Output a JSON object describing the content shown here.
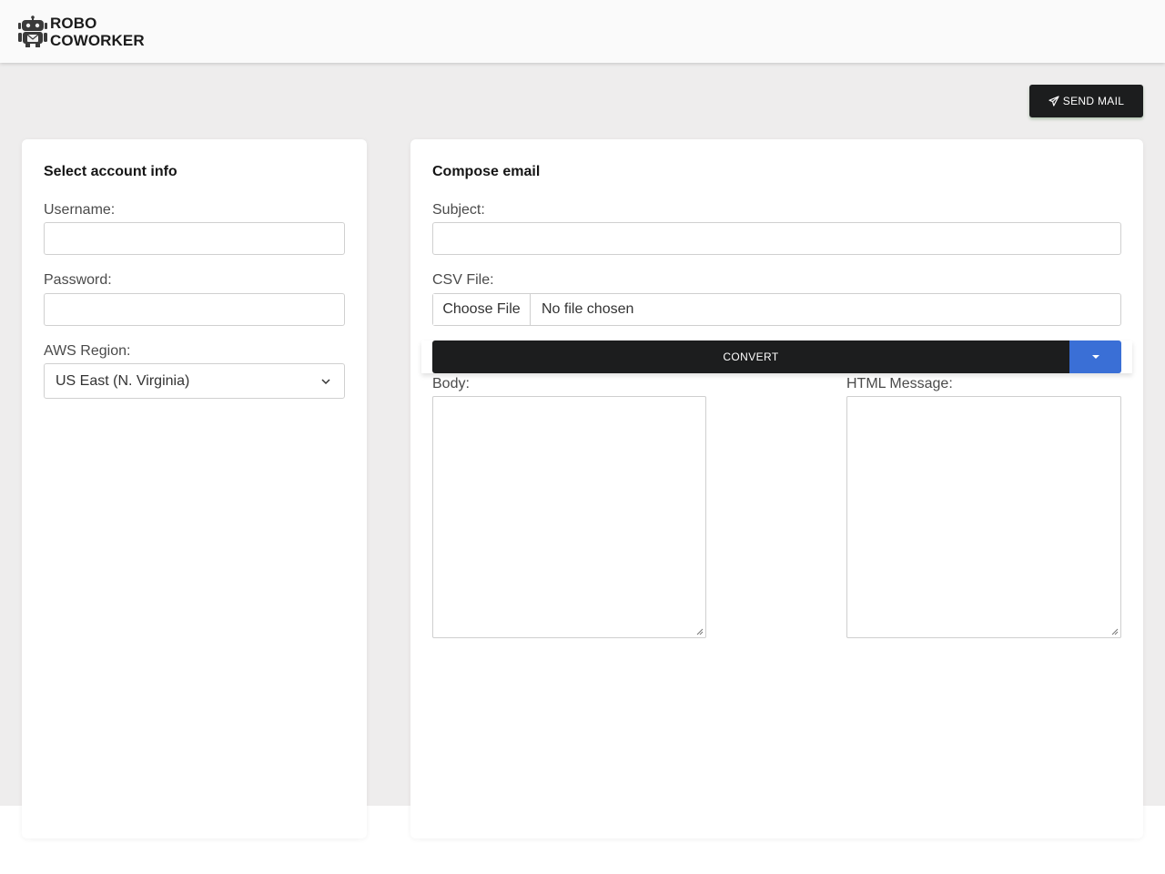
{
  "brand": {
    "line1": "ROBO",
    "line2": "COWORKER",
    "icon": "robot-mail-icon"
  },
  "toolbar": {
    "send_label": "SEND MAIL",
    "send_icon": "paper-plane-icon"
  },
  "account": {
    "title": "Select account info",
    "username_label": "Username:",
    "username_value": "",
    "password_label": "Password:",
    "password_value": "",
    "region_label": "AWS Region:",
    "region_value": "US East (N. Virginia)"
  },
  "compose": {
    "title": "Compose email",
    "subject_label": "Subject:",
    "subject_value": "",
    "csv_label": "CSV File:",
    "choose_file_label": "Choose File",
    "file_status": "No file chosen",
    "convert_label": "CONVERT",
    "body_label": "Body:",
    "html_label": "HTML Message:"
  },
  "colors": {
    "dark": "#1c1d1e",
    "accent": "#3a6fd6",
    "page_bg": "#eeeded"
  }
}
